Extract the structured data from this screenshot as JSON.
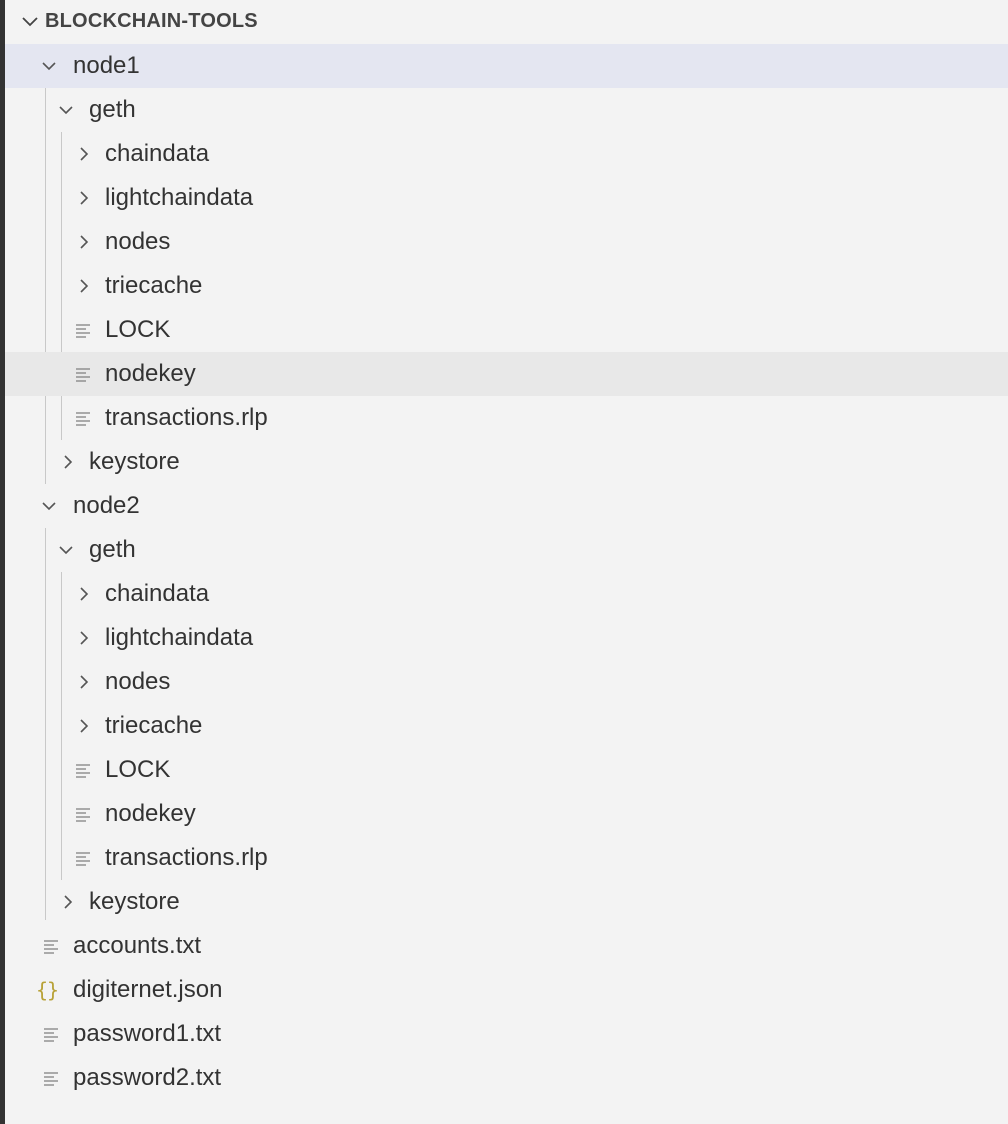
{
  "explorer": {
    "section_title": "BLOCKCHAIN-TOOLS",
    "items": [
      {
        "label": "node1",
        "kind": "folder",
        "expanded": true,
        "selected": true
      },
      {
        "label": "geth",
        "kind": "folder",
        "expanded": true
      },
      {
        "label": "chaindata",
        "kind": "folder",
        "expanded": false
      },
      {
        "label": "lightchaindata",
        "kind": "folder",
        "expanded": false
      },
      {
        "label": "nodes",
        "kind": "folder",
        "expanded": false
      },
      {
        "label": "triecache",
        "kind": "folder",
        "expanded": false
      },
      {
        "label": "LOCK",
        "kind": "file",
        "icon": "text-file-icon"
      },
      {
        "label": "nodekey",
        "kind": "file",
        "icon": "text-file-icon",
        "hovered": true
      },
      {
        "label": "transactions.rlp",
        "kind": "file",
        "icon": "text-file-icon"
      },
      {
        "label": "keystore",
        "kind": "folder",
        "expanded": false
      },
      {
        "label": "node2",
        "kind": "folder",
        "expanded": true
      },
      {
        "label": "geth",
        "kind": "folder",
        "expanded": true
      },
      {
        "label": "chaindata",
        "kind": "folder",
        "expanded": false
      },
      {
        "label": "lightchaindata",
        "kind": "folder",
        "expanded": false
      },
      {
        "label": "nodes",
        "kind": "folder",
        "expanded": false
      },
      {
        "label": "triecache",
        "kind": "folder",
        "expanded": false
      },
      {
        "label": "LOCK",
        "kind": "file",
        "icon": "text-file-icon"
      },
      {
        "label": "nodekey",
        "kind": "file",
        "icon": "text-file-icon"
      },
      {
        "label": "transactions.rlp",
        "kind": "file",
        "icon": "text-file-icon"
      },
      {
        "label": "keystore",
        "kind": "folder",
        "expanded": false
      },
      {
        "label": "accounts.txt",
        "kind": "file",
        "icon": "text-file-icon"
      },
      {
        "label": "digiternet.json",
        "kind": "file",
        "icon": "json-file-icon"
      },
      {
        "label": "password1.txt",
        "kind": "file",
        "icon": "text-file-icon"
      },
      {
        "label": "password2.txt",
        "kind": "file",
        "icon": "text-file-icon"
      }
    ]
  },
  "colors": {
    "background": "#f3f3f3",
    "selected_row": "#e4e6f1",
    "hovered_row": "#e8e8e8",
    "text": "#333333",
    "json_icon": "#b8a238"
  }
}
